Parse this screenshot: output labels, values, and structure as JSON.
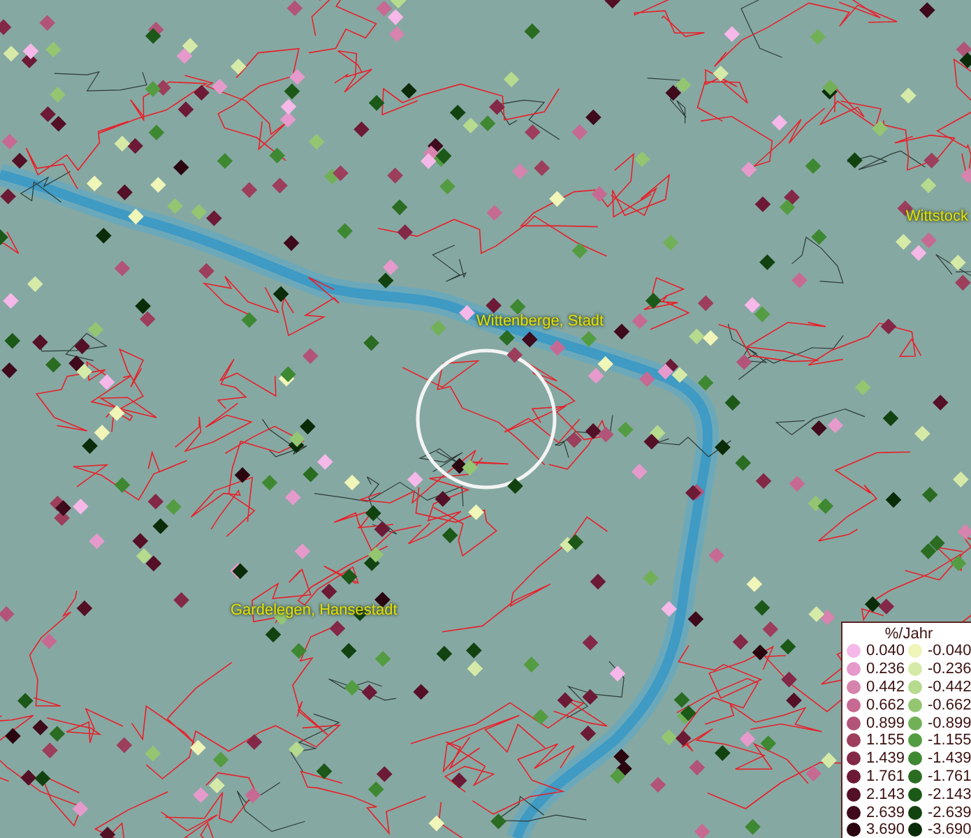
{
  "map": {
    "place_labels": [
      {
        "text": "Wittenberge, Stadt"
      },
      {
        "text": "Wittstock"
      },
      {
        "text": "Gardelegen, Hansestadt"
      }
    ]
  },
  "legend": {
    "title": "%/Jahr",
    "entries": [
      {
        "value": "0.040",
        "color": "#f5b8e8"
      },
      {
        "value": "-0.040",
        "color": "#f0f5b8"
      },
      {
        "value": "0.236",
        "color": "#e69acb"
      },
      {
        "value": "-0.236",
        "color": "#d6eaa8"
      },
      {
        "value": "0.442",
        "color": "#d683ae"
      },
      {
        "value": "-0.442",
        "color": "#b6da8e"
      },
      {
        "value": "0.662",
        "color": "#c66a93"
      },
      {
        "value": "-0.662",
        "color": "#94c672"
      },
      {
        "value": "0.899",
        "color": "#b25478"
      },
      {
        "value": "-0.899",
        "color": "#72b058"
      },
      {
        "value": "1.155",
        "color": "#9c3e5c"
      },
      {
        "value": "-1.155",
        "color": "#549c42"
      },
      {
        "value": "1.439",
        "color": "#842848"
      },
      {
        "value": "-1.439",
        "color": "#3e8832"
      },
      {
        "value": "1.761",
        "color": "#6c1a36"
      },
      {
        "value": "-1.761",
        "color": "#2a6c22"
      },
      {
        "value": "2.143",
        "color": "#541026"
      },
      {
        "value": "-2.143",
        "color": "#1c5818"
      },
      {
        "value": "2.639",
        "color": "#3e0a1c"
      },
      {
        "value": "-2.639",
        "color": "#124210"
      },
      {
        "value": "3.690",
        "color": "#2a0510"
      },
      {
        "value": "-3.690",
        "color": "#0a2c08"
      }
    ]
  }
}
